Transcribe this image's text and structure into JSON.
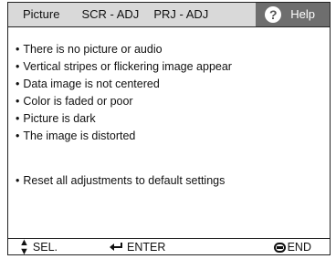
{
  "tabs": [
    {
      "label": "Picture"
    },
    {
      "label": "SCR - ADJ"
    },
    {
      "label": "PRJ - ADJ"
    },
    {
      "label": "Help",
      "icon": "question-icon",
      "active": true
    }
  ],
  "help_items": [
    "There is no picture or audio",
    "Vertical stripes or flickering image appear",
    "Data image is not centered",
    "Color is faded or poor",
    "Picture is dark",
    "The image is distorted"
  ],
  "reset_item": "Reset all adjustments to default settings",
  "footer": {
    "sel_label": "SEL.",
    "sel_icon": "up-down-arrows-icon",
    "enter_label": "ENTER",
    "enter_icon": "enter-arrow-icon",
    "end_label": "END",
    "end_icon": "end-button-icon"
  }
}
